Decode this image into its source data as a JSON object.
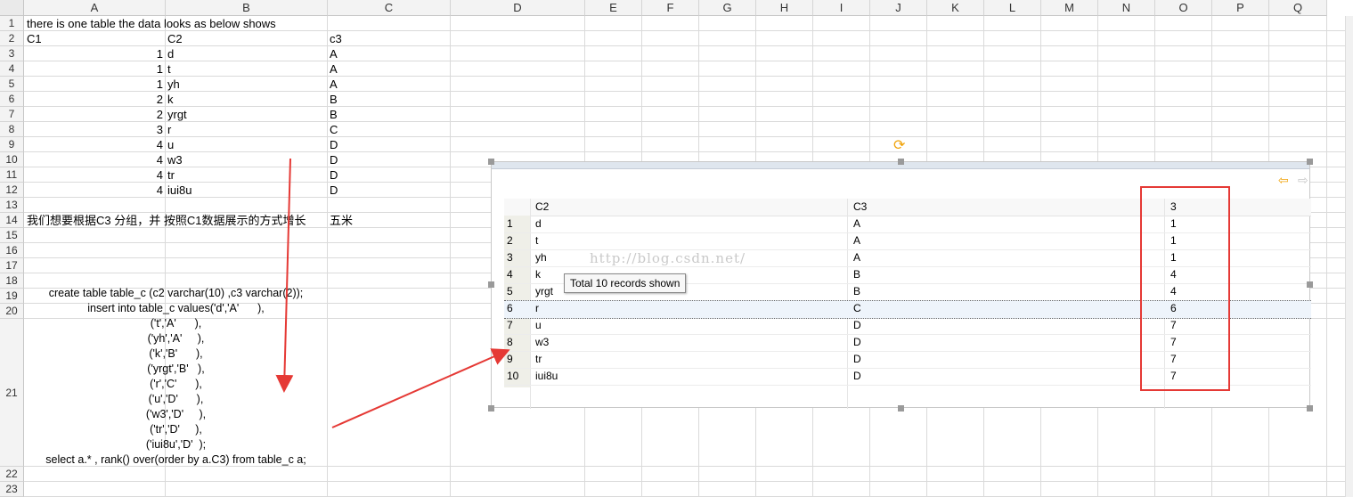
{
  "sheet": {
    "columns": [
      "A",
      "B",
      "C",
      "D",
      "E",
      "F",
      "G",
      "H",
      "I",
      "J",
      "K",
      "L",
      "M",
      "N",
      "O",
      "P",
      "Q"
    ],
    "rows": [
      "1",
      "2",
      "3",
      "4",
      "5",
      "6",
      "7",
      "8",
      "9",
      "10",
      "11",
      "12",
      "13",
      "14",
      "15",
      "16",
      "17",
      "18",
      "19",
      "20",
      "21",
      "22",
      "23"
    ],
    "title_text": "there is one table the data looks as below shows",
    "headers": [
      "C1",
      "C2",
      "c3"
    ],
    "data": [
      [
        "1",
        "d",
        "A"
      ],
      [
        "1",
        "t",
        "A"
      ],
      [
        "1",
        "yh",
        "A"
      ],
      [
        "2",
        "k",
        "B"
      ],
      [
        "2",
        "yrgt",
        "B"
      ],
      [
        "3",
        "r",
        "C"
      ],
      [
        "4",
        "u",
        "D"
      ],
      [
        "4",
        "w3",
        "D"
      ],
      [
        "4",
        "tr",
        "D"
      ],
      [
        "4",
        "iui8u",
        "D"
      ]
    ],
    "note_cn": "我们想要根据C3 分组，并 按照C1数据展示的方式增长",
    "note_cn2": "五米",
    "sql_lines": [
      "create table table_c (c2 varchar(10) ,c3 varchar(2));",
      "insert into table_c values('d','A'      ),",
      "('t','A'      ),",
      "('yh','A'     ),",
      "('k','B'      ),",
      "('yrgt','B'   ),",
      "('r','C'      ),",
      "('u','D'      ),",
      "('w3','D'     ),",
      "('tr','D'     ),",
      "('iui8u','D'  );",
      "select a.* , rank() over(order by a.C3) from table_c a;"
    ]
  },
  "result": {
    "headers": [
      "C2",
      "C3",
      "3"
    ],
    "rows": [
      [
        "1",
        "d",
        "A",
        "1"
      ],
      [
        "2",
        "t",
        "A",
        "1"
      ],
      [
        "3",
        "yh",
        "A",
        "1"
      ],
      [
        "4",
        "k",
        "B",
        "4"
      ],
      [
        "5",
        "yrgt",
        "B",
        "4"
      ],
      [
        "6",
        "r",
        "C",
        "6"
      ],
      [
        "7",
        "u",
        "D",
        "7"
      ],
      [
        "8",
        "w3",
        "D",
        "7"
      ],
      [
        "9",
        "tr",
        "D",
        "7"
      ],
      [
        "10",
        "iui8u",
        "D",
        "7"
      ]
    ],
    "selected_row": 6,
    "tooltip": "Total 10 records shown",
    "watermark": "http://blog.csdn.net/",
    "nav_back_icon": "arrow-left-icon",
    "nav_forward_icon": "arrow-right-icon",
    "refresh_icon": "rotate-handle-icon"
  },
  "colors": {
    "accent_red": "#e53935",
    "nav_orange": "#f0a30a",
    "grid": "#dadada"
  }
}
